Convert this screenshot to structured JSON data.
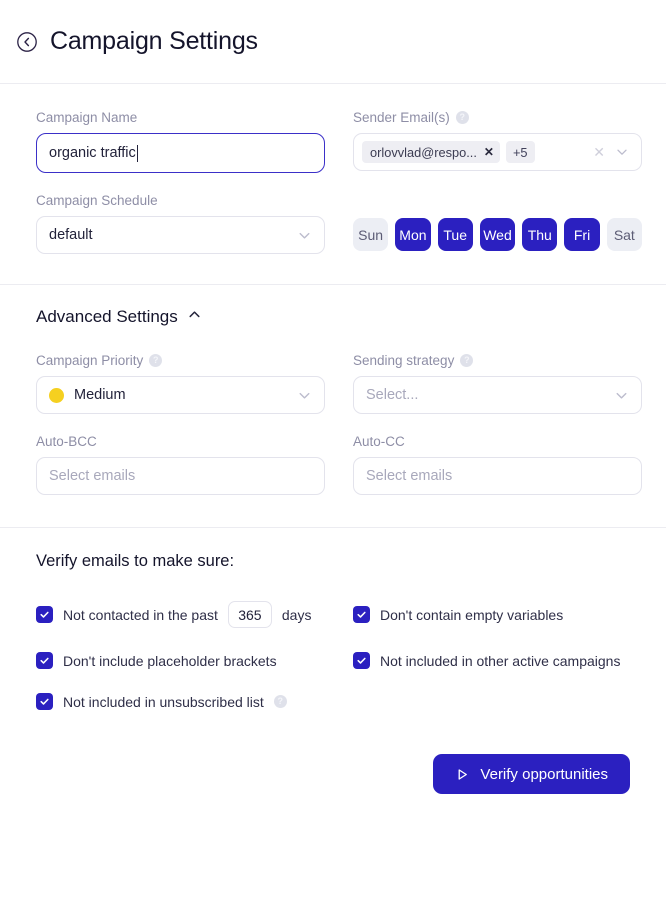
{
  "header": {
    "back_icon": "circle-chevron-left-icon",
    "title": "Campaign Settings"
  },
  "campaign": {
    "name_label": "Campaign Name",
    "name_value": "organic traffic",
    "schedule_label": "Campaign Schedule",
    "schedule_value": "default",
    "sender_label": "Sender Email(s)",
    "sender_help": "?",
    "sender_chip": "orlovvlad@respo...",
    "sender_chip_remove": "✕",
    "sender_more": "+5",
    "sender_clear": "✕",
    "days": [
      {
        "label": "Sun",
        "selected": false
      },
      {
        "label": "Mon",
        "selected": true
      },
      {
        "label": "Tue",
        "selected": true
      },
      {
        "label": "Wed",
        "selected": true
      },
      {
        "label": "Thu",
        "selected": true
      },
      {
        "label": "Fri",
        "selected": true
      },
      {
        "label": "Sat",
        "selected": false
      }
    ]
  },
  "advanced": {
    "title": "Advanced Settings",
    "expanded": true,
    "priority_label": "Campaign Priority",
    "priority_help": "?",
    "priority_value": "Medium",
    "priority_color": "#f5d020",
    "strategy_label": "Sending strategy",
    "strategy_help": "?",
    "strategy_placeholder": "Select...",
    "bcc_label": "Auto-BCC",
    "bcc_placeholder": "Select emails",
    "cc_label": "Auto-CC",
    "cc_placeholder": "Select emails"
  },
  "verify": {
    "title": "Verify emails to make sure:",
    "not_contacted_prefix": "Not contacted in the past",
    "not_contacted_days": "365",
    "not_contacted_suffix": "days",
    "empty_variables": "Don't contain empty variables",
    "placeholder_brackets": "Don't include placeholder brackets",
    "other_campaigns": "Not included in other active campaigns",
    "unsubscribed": "Not included in unsubscribed list",
    "unsubscribed_help": "?",
    "checked": true
  },
  "footer": {
    "verify_button": "Verify opportunities",
    "verify_icon": "play-icon"
  },
  "colors": {
    "primary": "#2b20c0",
    "focus_border": "#3b30c8",
    "day_off_bg": "#eceef4",
    "label": "#8e8ea6",
    "divider": "#ececf1"
  }
}
